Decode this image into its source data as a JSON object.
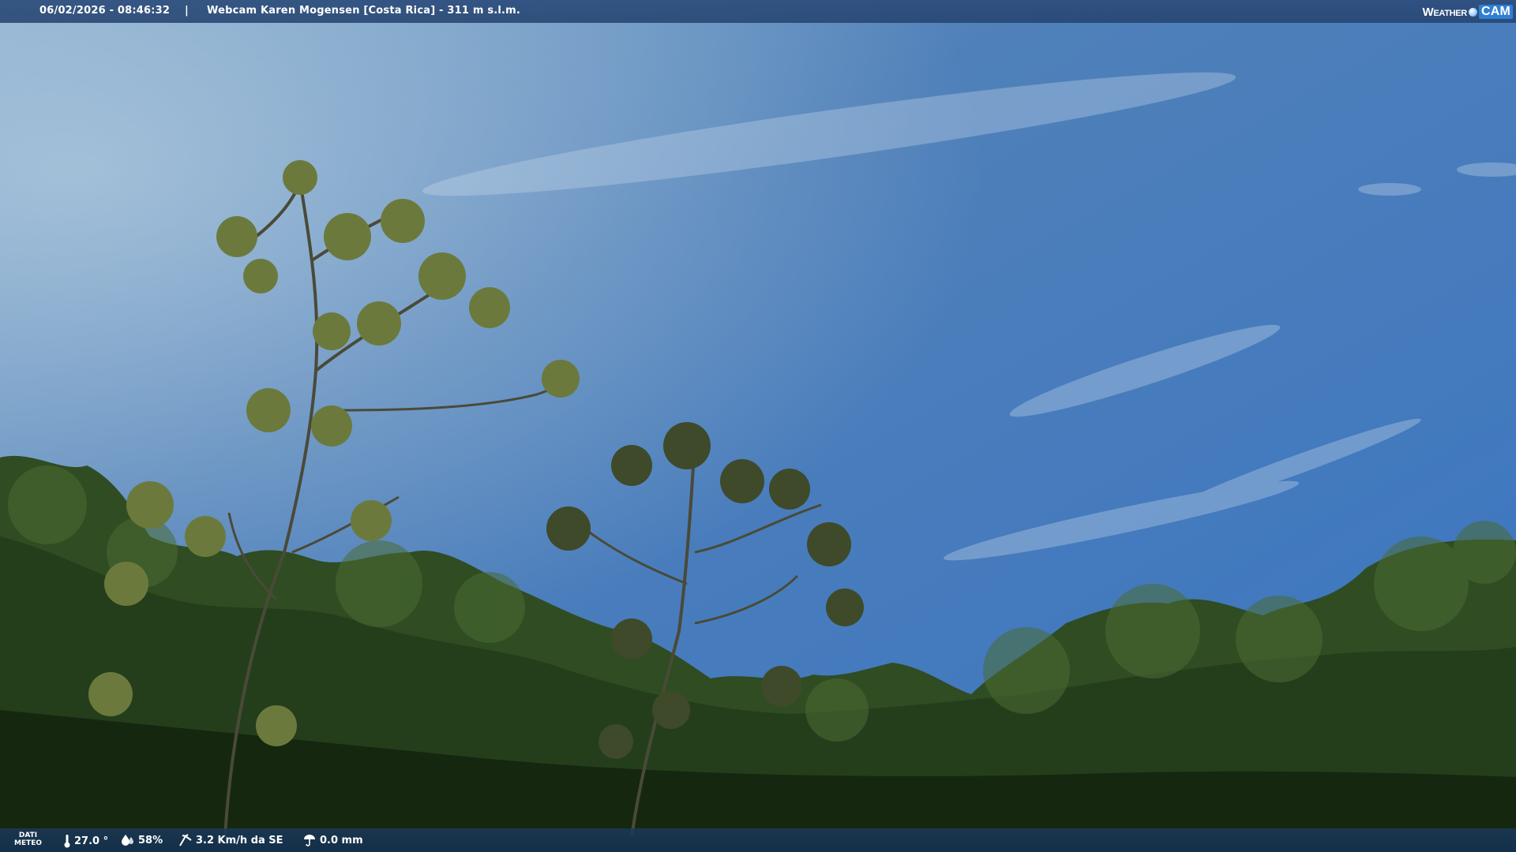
{
  "header": {
    "timestamp": "06/02/2026 - 08:46:32",
    "separator": "|",
    "title": "Webcam Karen Mogensen [Costa Rica]  - 311 m s.l.m.",
    "brand_part1": "Weather",
    "brand_part2": "CAM"
  },
  "footer": {
    "label_line1": "DATI",
    "label_line2": "METEO",
    "temperature": "27.0 °",
    "humidity": "58%",
    "wind": "3.2 Km/h da SE",
    "rain": "0.0 mm"
  },
  "icons": {
    "temperature": "thermometer-icon",
    "humidity": "humidity-icon",
    "wind": "wind-icon",
    "rain": "rain-icon",
    "brand": "globe-icon"
  },
  "colors": {
    "sky_top": "#5b86b5",
    "sky_bottom": "#3f78c0",
    "foliage": "#2e4a22",
    "bar": "#2b4d7e"
  }
}
